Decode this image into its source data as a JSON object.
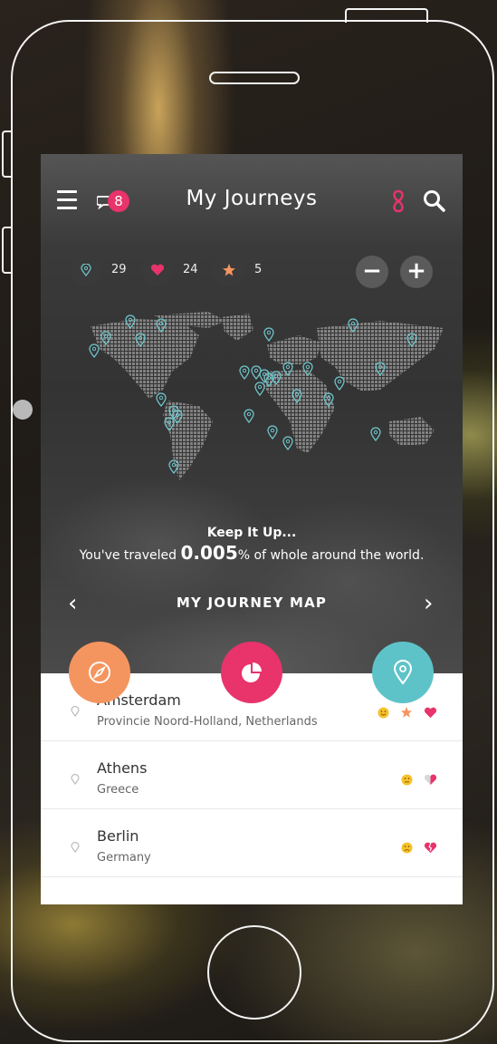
{
  "header": {
    "title": "My Journeys",
    "chat_badge": "8"
  },
  "stats": {
    "pins": "29",
    "likes": "24",
    "stars": "5"
  },
  "zoom": {
    "out_label": "−",
    "in_label": "+"
  },
  "message": {
    "headline": "Keep It Up...",
    "prefix": "You've traveled ",
    "value": "0.005",
    "suffix": "% of whole around the world."
  },
  "map_nav": {
    "label": "MY JOURNEY MAP",
    "prev": "‹",
    "next": "›"
  },
  "colors": {
    "accent_pink": "#e8336b",
    "accent_orange": "#f4955f",
    "accent_teal": "#5ec3c9",
    "pin": "#6fc6cc"
  },
  "actions": [
    "compass-button",
    "stats-button",
    "location-button"
  ],
  "journeys": [
    {
      "city": "Amsterdam",
      "region": "Provincie Noord-Holland, Netherlands",
      "mood": "smile",
      "starred": true,
      "heart": "full"
    },
    {
      "city": "Athens",
      "region": "Greece",
      "mood": "neutral",
      "starred": false,
      "heart": "half"
    },
    {
      "city": "Berlin",
      "region": "Germany",
      "mood": "sad",
      "starred": false,
      "heart": "broken"
    }
  ]
}
